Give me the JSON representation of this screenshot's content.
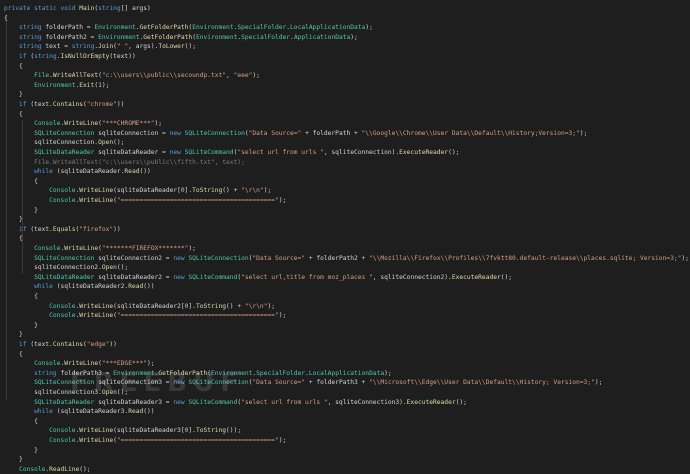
{
  "code": {
    "lines": [
      [
        {
          "t": "private ",
          "c": "kw"
        },
        {
          "t": "static ",
          "c": "kw"
        },
        {
          "t": "void ",
          "c": "kw"
        },
        {
          "t": "Main",
          "c": "fn"
        },
        {
          "t": "(",
          "c": "pn"
        },
        {
          "t": "string",
          "c": "kw"
        },
        {
          "t": "[] args)",
          "c": "pn"
        }
      ],
      [
        {
          "t": "{",
          "c": "pn"
        }
      ],
      [
        {
          "t": "    string ",
          "c": "kw"
        },
        {
          "t": "folderPath = ",
          "c": "pn"
        },
        {
          "t": "Environment",
          "c": "ty"
        },
        {
          "t": ".",
          "c": "pn"
        },
        {
          "t": "GetFolderPath",
          "c": "fn"
        },
        {
          "t": "(",
          "c": "pn"
        },
        {
          "t": "Environment",
          "c": "ty"
        },
        {
          "t": ".",
          "c": "pn"
        },
        {
          "t": "SpecialFolder",
          "c": "ty"
        },
        {
          "t": ".",
          "c": "pn"
        },
        {
          "t": "LocalApplicationData",
          "c": "ty"
        },
        {
          "t": ");",
          "c": "pn"
        }
      ],
      [
        {
          "t": "    string ",
          "c": "kw"
        },
        {
          "t": "folderPath2 = ",
          "c": "pn"
        },
        {
          "t": "Environment",
          "c": "ty"
        },
        {
          "t": ".",
          "c": "pn"
        },
        {
          "t": "GetFolderPath",
          "c": "fn"
        },
        {
          "t": "(",
          "c": "pn"
        },
        {
          "t": "Environment",
          "c": "ty"
        },
        {
          "t": ".",
          "c": "pn"
        },
        {
          "t": "SpecialFolder",
          "c": "ty"
        },
        {
          "t": ".",
          "c": "pn"
        },
        {
          "t": "ApplicationData",
          "c": "ty"
        },
        {
          "t": ");",
          "c": "pn"
        }
      ],
      [
        {
          "t": "    string ",
          "c": "kw"
        },
        {
          "t": "text = ",
          "c": "pn"
        },
        {
          "t": "string",
          "c": "kw"
        },
        {
          "t": ".",
          "c": "pn"
        },
        {
          "t": "Join",
          "c": "fn"
        },
        {
          "t": "(",
          "c": "pn"
        },
        {
          "t": "\" \"",
          "c": "st"
        },
        {
          "t": ", args).",
          "c": "pn"
        },
        {
          "t": "ToLower",
          "c": "fn"
        },
        {
          "t": "();",
          "c": "pn"
        }
      ],
      [
        {
          "t": "    if ",
          "c": "kw"
        },
        {
          "t": "(",
          "c": "pn"
        },
        {
          "t": "string",
          "c": "kw"
        },
        {
          "t": ".",
          "c": "pn"
        },
        {
          "t": "IsNullOrEmpty",
          "c": "fn"
        },
        {
          "t": "(text))",
          "c": "pn"
        }
      ],
      [
        {
          "t": "    {",
          "c": "pn"
        }
      ],
      [
        {
          "t": "        File",
          "c": "ty"
        },
        {
          "t": ".",
          "c": "pn"
        },
        {
          "t": "WriteAllText",
          "c": "fn"
        },
        {
          "t": "(",
          "c": "pn"
        },
        {
          "t": "\"c:\\\\users\\\\public\\\\secoundp.txt\"",
          "c": "st"
        },
        {
          "t": ", ",
          "c": "pn"
        },
        {
          "t": "\"eee\"",
          "c": "st"
        },
        {
          "t": ");",
          "c": "pn"
        }
      ],
      [
        {
          "t": "        Environment",
          "c": "ty"
        },
        {
          "t": ".",
          "c": "pn"
        },
        {
          "t": "Exit",
          "c": "fn"
        },
        {
          "t": "(",
          "c": "pn"
        },
        {
          "t": "1",
          "c": "nm"
        },
        {
          "t": ");",
          "c": "pn"
        }
      ],
      [
        {
          "t": "    }",
          "c": "pn"
        }
      ],
      [
        {
          "t": "    if ",
          "c": "kw"
        },
        {
          "t": "(text.",
          "c": "pn"
        },
        {
          "t": "Contains",
          "c": "fn"
        },
        {
          "t": "(",
          "c": "pn"
        },
        {
          "t": "\"chrome\"",
          "c": "st"
        },
        {
          "t": "))",
          "c": "pn"
        }
      ],
      [
        {
          "t": "    {",
          "c": "pn"
        }
      ],
      [
        {
          "t": "        Console",
          "c": "ty"
        },
        {
          "t": ".",
          "c": "pn"
        },
        {
          "t": "WriteLine",
          "c": "fn"
        },
        {
          "t": "(",
          "c": "pn"
        },
        {
          "t": "\"***CHROME***\"",
          "c": "st"
        },
        {
          "t": ");",
          "c": "pn"
        }
      ],
      [
        {
          "t": "        SQLiteConnection ",
          "c": "ty"
        },
        {
          "t": "sqliteConnection = ",
          "c": "pn"
        },
        {
          "t": "new ",
          "c": "kw"
        },
        {
          "t": "SQLiteConnection",
          "c": "ty"
        },
        {
          "t": "(",
          "c": "pn"
        },
        {
          "t": "\"Data Source=\"",
          "c": "st"
        },
        {
          "t": " + folderPath + ",
          "c": "pn"
        },
        {
          "t": "\"\\\\Google\\\\Chrome\\\\User Data\\\\Default\\\\History;Version=3;\"",
          "c": "st"
        },
        {
          "t": ");",
          "c": "pn"
        }
      ],
      [
        {
          "t": "        sqliteConnection.",
          "c": "pn"
        },
        {
          "t": "Open",
          "c": "fn"
        },
        {
          "t": "();",
          "c": "pn"
        }
      ],
      [
        {
          "t": "        SQLiteDataReader ",
          "c": "ty"
        },
        {
          "t": "sqliteDataReader = ",
          "c": "pn"
        },
        {
          "t": "new ",
          "c": "kw"
        },
        {
          "t": "SQLiteCommand",
          "c": "ty"
        },
        {
          "t": "(",
          "c": "pn"
        },
        {
          "t": "\"select url from urls \"",
          "c": "st"
        },
        {
          "t": ", sqliteConnection).",
          "c": "pn"
        },
        {
          "t": "ExecuteReader",
          "c": "fn"
        },
        {
          "t": "();",
          "c": "pn"
        }
      ],
      [
        {
          "t": "        File",
          "c": "dim"
        },
        {
          "t": ".",
          "c": "dim"
        },
        {
          "t": "WriteAllText",
          "c": "dim"
        },
        {
          "t": "(",
          "c": "dim"
        },
        {
          "t": "\"c:\\\\users\\\\public\\\\fifth.txt\"",
          "c": "dim"
        },
        {
          "t": ", text);",
          "c": "dim"
        }
      ],
      [
        {
          "t": "        while ",
          "c": "kw"
        },
        {
          "t": "(sqliteDataReader.",
          "c": "pn"
        },
        {
          "t": "Read",
          "c": "fn"
        },
        {
          "t": "())",
          "c": "pn"
        }
      ],
      [
        {
          "t": "        {",
          "c": "pn"
        }
      ],
      [
        {
          "t": "            Console",
          "c": "ty"
        },
        {
          "t": ".",
          "c": "pn"
        },
        {
          "t": "WriteLine",
          "c": "fn"
        },
        {
          "t": "(sqliteDataReader[",
          "c": "pn"
        },
        {
          "t": "0",
          "c": "nm"
        },
        {
          "t": "].",
          "c": "pn"
        },
        {
          "t": "ToString",
          "c": "fn"
        },
        {
          "t": "() + ",
          "c": "pn"
        },
        {
          "t": "\"\\r\\n\"",
          "c": "st"
        },
        {
          "t": ");",
          "c": "pn"
        }
      ],
      [
        {
          "t": "            Console",
          "c": "ty"
        },
        {
          "t": ".",
          "c": "pn"
        },
        {
          "t": "WriteLine",
          "c": "fn"
        },
        {
          "t": "(",
          "c": "pn"
        },
        {
          "t": "\"=========================================\"",
          "c": "st"
        },
        {
          "t": ");",
          "c": "pn"
        }
      ],
      [
        {
          "t": "        }",
          "c": "pn"
        }
      ],
      [
        {
          "t": "    }",
          "c": "pn"
        }
      ],
      [
        {
          "t": "    if ",
          "c": "kw"
        },
        {
          "t": "(text.",
          "c": "pn"
        },
        {
          "t": "Equals",
          "c": "fn"
        },
        {
          "t": "(",
          "c": "pn"
        },
        {
          "t": "\"firefox\"",
          "c": "st"
        },
        {
          "t": "))",
          "c": "pn"
        }
      ],
      [
        {
          "t": "    {",
          "c": "pn"
        }
      ],
      [
        {
          "t": "        Console",
          "c": "ty"
        },
        {
          "t": ".",
          "c": "pn"
        },
        {
          "t": "WriteLine",
          "c": "fn"
        },
        {
          "t": "(",
          "c": "pn"
        },
        {
          "t": "\"*******FIREFOX*******\"",
          "c": "st"
        },
        {
          "t": ");",
          "c": "pn"
        }
      ],
      [
        {
          "t": "        SQLiteConnection ",
          "c": "ty"
        },
        {
          "t": "sqliteConnection2 = ",
          "c": "pn"
        },
        {
          "t": "new ",
          "c": "kw"
        },
        {
          "t": "SQLiteConnection",
          "c": "ty"
        },
        {
          "t": "(",
          "c": "pn"
        },
        {
          "t": "\"Data Source=\"",
          "c": "st"
        },
        {
          "t": " + folderPath2 + ",
          "c": "pn"
        },
        {
          "t": "\"\\\\Mozilla\\\\Firefox\\\\Profiles\\\\7fvktt80.default-release\\\\places.sqlite; Version=3;\"",
          "c": "st"
        },
        {
          "t": ");",
          "c": "pn"
        }
      ],
      [
        {
          "t": "        sqliteConnection2.",
          "c": "pn"
        },
        {
          "t": "Open",
          "c": "fn"
        },
        {
          "t": "();",
          "c": "pn"
        }
      ],
      [
        {
          "t": "        SQLiteDataReader ",
          "c": "ty"
        },
        {
          "t": "sqliteDataReader2 = ",
          "c": "pn"
        },
        {
          "t": "new ",
          "c": "kw"
        },
        {
          "t": "SQLiteCommand",
          "c": "ty"
        },
        {
          "t": "(",
          "c": "pn"
        },
        {
          "t": "\"select url,title from moz_places \"",
          "c": "st"
        },
        {
          "t": ", sqliteConnection2).",
          "c": "pn"
        },
        {
          "t": "ExecuteReader",
          "c": "fn"
        },
        {
          "t": "();",
          "c": "pn"
        }
      ],
      [
        {
          "t": "        while ",
          "c": "kw"
        },
        {
          "t": "(sqliteDataReader2.",
          "c": "pn"
        },
        {
          "t": "Read",
          "c": "fn"
        },
        {
          "t": "())",
          "c": "pn"
        }
      ],
      [
        {
          "t": "        {",
          "c": "pn"
        }
      ],
      [
        {
          "t": "            Console",
          "c": "ty"
        },
        {
          "t": ".",
          "c": "pn"
        },
        {
          "t": "WriteLine",
          "c": "fn"
        },
        {
          "t": "(sqliteDataReader2[",
          "c": "pn"
        },
        {
          "t": "0",
          "c": "nm"
        },
        {
          "t": "].",
          "c": "pn"
        },
        {
          "t": "ToString",
          "c": "fn"
        },
        {
          "t": "() + ",
          "c": "pn"
        },
        {
          "t": "\"\\r\\n\"",
          "c": "st"
        },
        {
          "t": ");",
          "c": "pn"
        }
      ],
      [
        {
          "t": "            Console",
          "c": "ty"
        },
        {
          "t": ".",
          "c": "pn"
        },
        {
          "t": "WriteLine",
          "c": "fn"
        },
        {
          "t": "(",
          "c": "pn"
        },
        {
          "t": "\"=========================================\"",
          "c": "st"
        },
        {
          "t": ");",
          "c": "pn"
        }
      ],
      [
        {
          "t": "        }",
          "c": "pn"
        }
      ],
      [
        {
          "t": "    }",
          "c": "pn"
        }
      ],
      [
        {
          "t": "    if ",
          "c": "kw"
        },
        {
          "t": "(text.",
          "c": "pn"
        },
        {
          "t": "Contains",
          "c": "fn"
        },
        {
          "t": "(",
          "c": "pn"
        },
        {
          "t": "\"edge\"",
          "c": "st"
        },
        {
          "t": "))",
          "c": "pn"
        }
      ],
      [
        {
          "t": "    {",
          "c": "pn"
        }
      ],
      [
        {
          "t": "        Console",
          "c": "ty"
        },
        {
          "t": ".",
          "c": "pn"
        },
        {
          "t": "WriteLine",
          "c": "fn"
        },
        {
          "t": "(",
          "c": "pn"
        },
        {
          "t": "\"***EDGE***\"",
          "c": "st"
        },
        {
          "t": ");",
          "c": "pn"
        }
      ],
      [
        {
          "t": "        string ",
          "c": "kw"
        },
        {
          "t": "folderPath3 = ",
          "c": "pn"
        },
        {
          "t": "Environment",
          "c": "ty"
        },
        {
          "t": ".",
          "c": "pn"
        },
        {
          "t": "GetFolderPath",
          "c": "fn"
        },
        {
          "t": "(",
          "c": "pn"
        },
        {
          "t": "Environment",
          "c": "ty"
        },
        {
          "t": ".",
          "c": "pn"
        },
        {
          "t": "SpecialFolder",
          "c": "ty"
        },
        {
          "t": ".",
          "c": "pn"
        },
        {
          "t": "LocalApplicationData",
          "c": "ty"
        },
        {
          "t": ");",
          "c": "pn"
        }
      ],
      [
        {
          "t": "        SQLiteConnection ",
          "c": "ty"
        },
        {
          "t": "sqliteConnection3 = ",
          "c": "pn"
        },
        {
          "t": "new ",
          "c": "kw"
        },
        {
          "t": "SQLiteConnection",
          "c": "ty"
        },
        {
          "t": "(",
          "c": "pn"
        },
        {
          "t": "\"Data Source=\"",
          "c": "st"
        },
        {
          "t": " + folderPath3 + ",
          "c": "pn"
        },
        {
          "t": "\"\\\\Microsoft\\\\Edge\\\\User Data\\\\Default\\\\History; Version=3;\"",
          "c": "st"
        },
        {
          "t": ");",
          "c": "pn"
        }
      ],
      [
        {
          "t": "        sqliteConnection3.",
          "c": "pn"
        },
        {
          "t": "Open",
          "c": "fn"
        },
        {
          "t": "();",
          "c": "pn"
        }
      ],
      [
        {
          "t": "        SQLiteDataReader ",
          "c": "ty"
        },
        {
          "t": "sqliteDataReader3 = ",
          "c": "pn"
        },
        {
          "t": "new ",
          "c": "kw"
        },
        {
          "t": "SQLiteCommand",
          "c": "ty"
        },
        {
          "t": "(",
          "c": "pn"
        },
        {
          "t": "\"select url from urls \"",
          "c": "st"
        },
        {
          "t": ", sqliteConnection3).",
          "c": "pn"
        },
        {
          "t": "ExecuteReader",
          "c": "fn"
        },
        {
          "t": "();",
          "c": "pn"
        }
      ],
      [
        {
          "t": "        while ",
          "c": "kw"
        },
        {
          "t": "(sqliteDataReader3.",
          "c": "pn"
        },
        {
          "t": "Read",
          "c": "fn"
        },
        {
          "t": "())",
          "c": "pn"
        }
      ],
      [
        {
          "t": "        {",
          "c": "pn"
        }
      ],
      [
        {
          "t": "            Console",
          "c": "ty"
        },
        {
          "t": ".",
          "c": "pn"
        },
        {
          "t": "WriteLine",
          "c": "fn"
        },
        {
          "t": "(sqliteDataReader3[",
          "c": "pn"
        },
        {
          "t": "0",
          "c": "nm"
        },
        {
          "t": "].",
          "c": "pn"
        },
        {
          "t": "ToString",
          "c": "fn"
        },
        {
          "t": "());",
          "c": "pn"
        }
      ],
      [
        {
          "t": "            Console",
          "c": "ty"
        },
        {
          "t": ".",
          "c": "pn"
        },
        {
          "t": "WriteLine",
          "c": "fn"
        },
        {
          "t": "(",
          "c": "pn"
        },
        {
          "t": "\"=========================================\"",
          "c": "st"
        },
        {
          "t": ");",
          "c": "pn"
        }
      ],
      [
        {
          "t": "        }",
          "c": "pn"
        }
      ],
      [
        {
          "t": "    }",
          "c": "pn"
        }
      ],
      [
        {
          "t": "    Console",
          "c": "ty"
        },
        {
          "t": ".",
          "c": "pn"
        },
        {
          "t": "ReadLine",
          "c": "fn"
        },
        {
          "t": "();",
          "c": "pn"
        }
      ]
    ]
  },
  "watermark": {
    "text": "FREEBUF"
  },
  "colors": {
    "background": "#1e1e1e",
    "keyword": "#569cd6",
    "type": "#4ec9b0",
    "method": "#dcdcaa",
    "string": "#d69d85",
    "number": "#b5cea8",
    "plain": "#d4d4d4"
  }
}
